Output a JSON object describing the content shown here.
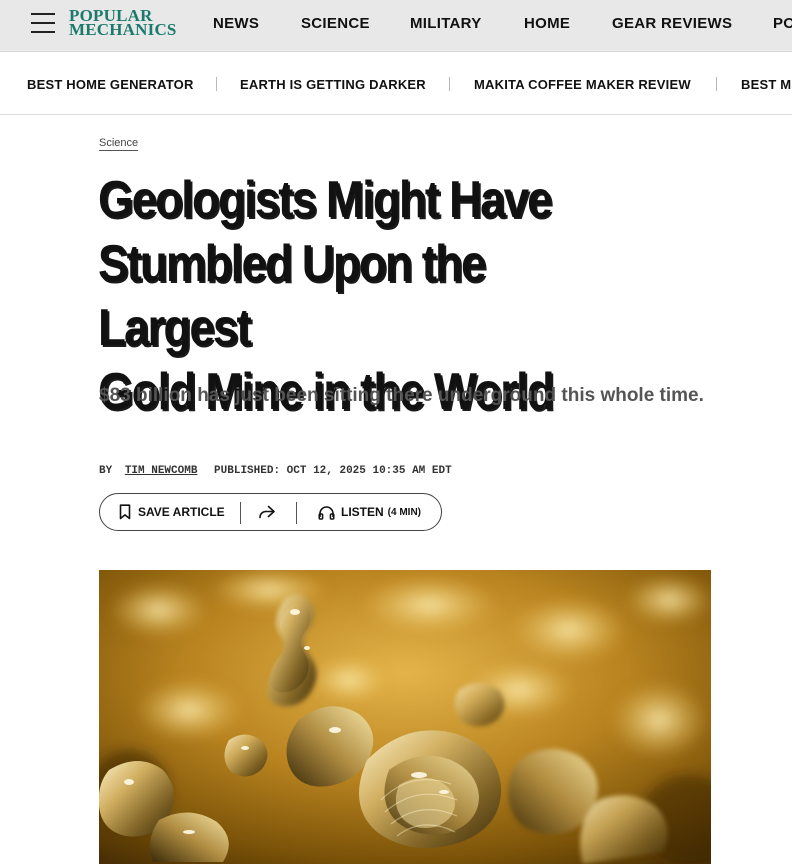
{
  "brand": {
    "line1": "POPULAR",
    "line2": "MECHANICS",
    "color": "#1c7a6b"
  },
  "nav": {
    "items": [
      "NEWS",
      "SCIENCE",
      "MILITARY",
      "HOME",
      "GEAR REVIEWS",
      "PO"
    ]
  },
  "trending": {
    "items": [
      "BEST HOME GENERATOR",
      "EARTH IS GETTING DARKER",
      "MAKITA COFFEE MAKER REVIEW",
      "BEST M"
    ]
  },
  "article": {
    "category": "Science",
    "headline_lines": [
      "Geologists Might Have",
      "Stumbled Upon the Largest",
      "Gold Mine in the World"
    ],
    "dek": "$83 billion has just been sitting there underground this whole time.",
    "byline_prefix": "BY",
    "author": "TIM NEWCOMB",
    "published": "PUBLISHED: OCT 12, 2025 10:35 AM EDT"
  },
  "actions": {
    "save_label": "SAVE ARTICLE",
    "listen_label": "LISTEN",
    "listen_duration": "(4 MIN)"
  },
  "icons": {
    "menu": "hamburger-menu-icon",
    "save": "bookmark-icon",
    "share": "share-arrow-icon",
    "listen": "headphones-icon"
  }
}
